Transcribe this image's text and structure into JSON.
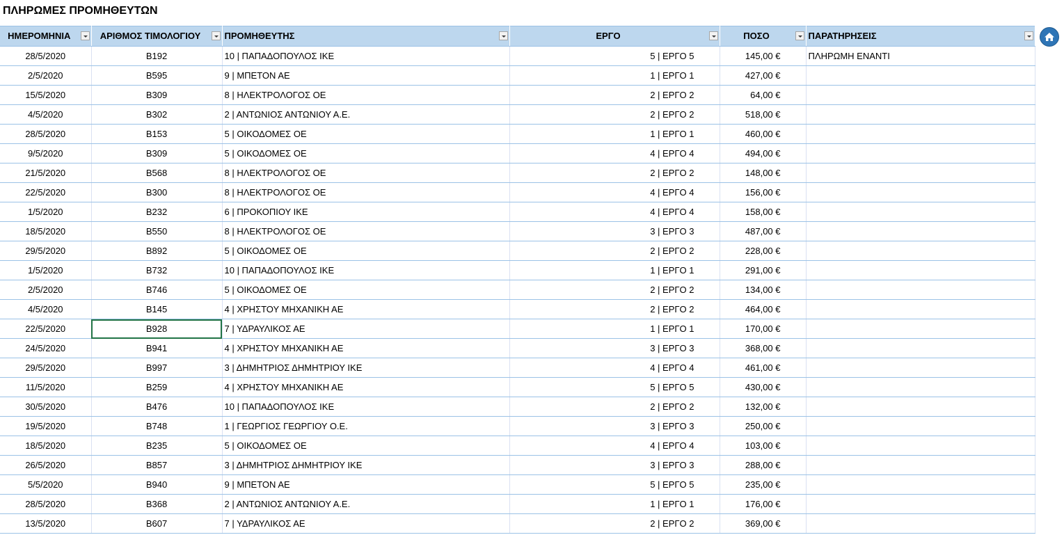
{
  "title": "ΠΛΗΡΩΜΕΣ ΠΡΟΜΗΘΕΥΤΩΝ",
  "columns": {
    "date": "ΗΜΕΡΟΜΗΝΙΑ",
    "invoice": "ΑΡΙΘΜΟΣ ΤΙΜΟΛΟΓΙΟΥ",
    "supplier": "ΠΡΟΜΗΘΕΥΤΗΣ",
    "project": "ΕΡΓΟ",
    "amount": "ΠΟΣΟ",
    "notes": "ΠΑΡΑΤΗΡΗΣΕΙΣ"
  },
  "icons": {
    "home": "home-icon",
    "filter": "filter-dropdown-icon"
  },
  "colors": {
    "header_bg": "#bdd7ee",
    "row_border": "#9bc2e6",
    "selection": "#217346",
    "home_button": "#2e75b6"
  },
  "selected_cell": {
    "row": 14,
    "column": "invoice"
  },
  "rows": [
    {
      "date": "28/5/2020",
      "invoice": "B192",
      "supplier": "10 | ΠΑΠΑΔΟΠΟΥΛΟΣ ΙΚΕ",
      "project": "5 | ΕΡΓΟ 5",
      "amount": "145,00 €",
      "notes": "ΠΛΗΡΩΜΗ ΕΝΑΝΤΙ"
    },
    {
      "date": "2/5/2020",
      "invoice": "B595",
      "supplier": "9 | ΜΠΕΤΟΝ ΑΕ",
      "project": "1 | ΕΡΓΟ 1",
      "amount": "427,00 €",
      "notes": ""
    },
    {
      "date": "15/5/2020",
      "invoice": "B309",
      "supplier": "8 | ΗΛΕΚΤΡΟΛΟΓΟΣ ΟΕ",
      "project": "2 | ΕΡΓΟ 2",
      "amount": "64,00 €",
      "notes": ""
    },
    {
      "date": "4/5/2020",
      "invoice": "B302",
      "supplier": "2 | ΑΝΤΩΝΙΟΣ ΑΝΤΩΝΙΟΥ Α.Ε.",
      "project": "2 | ΕΡΓΟ 2",
      "amount": "518,00 €",
      "notes": ""
    },
    {
      "date": "28/5/2020",
      "invoice": "B153",
      "supplier": "5 | ΟΙΚΟΔΟΜΕΣ ΟΕ",
      "project": "1 | ΕΡΓΟ 1",
      "amount": "460,00 €",
      "notes": ""
    },
    {
      "date": "9/5/2020",
      "invoice": "B309",
      "supplier": "5 | ΟΙΚΟΔΟΜΕΣ ΟΕ",
      "project": "4 | ΕΡΓΟ 4",
      "amount": "494,00 €",
      "notes": ""
    },
    {
      "date": "21/5/2020",
      "invoice": "B568",
      "supplier": "8 | ΗΛΕΚΤΡΟΛΟΓΟΣ ΟΕ",
      "project": "2 | ΕΡΓΟ 2",
      "amount": "148,00 €",
      "notes": ""
    },
    {
      "date": "22/5/2020",
      "invoice": "B300",
      "supplier": "8 | ΗΛΕΚΤΡΟΛΟΓΟΣ ΟΕ",
      "project": "4 | ΕΡΓΟ 4",
      "amount": "156,00 €",
      "notes": ""
    },
    {
      "date": "1/5/2020",
      "invoice": "B232",
      "supplier": "6 | ΠΡΟΚΟΠΙΟΥ ΙΚΕ",
      "project": "4 | ΕΡΓΟ 4",
      "amount": "158,00 €",
      "notes": ""
    },
    {
      "date": "18/5/2020",
      "invoice": "B550",
      "supplier": "8 | ΗΛΕΚΤΡΟΛΟΓΟΣ ΟΕ",
      "project": "3 | ΕΡΓΟ 3",
      "amount": "487,00 €",
      "notes": ""
    },
    {
      "date": "29/5/2020",
      "invoice": "B892",
      "supplier": "5 | ΟΙΚΟΔΟΜΕΣ ΟΕ",
      "project": "2 | ΕΡΓΟ 2",
      "amount": "228,00 €",
      "notes": ""
    },
    {
      "date": "1/5/2020",
      "invoice": "B732",
      "supplier": "10 | ΠΑΠΑΔΟΠΟΥΛΟΣ ΙΚΕ",
      "project": "1 | ΕΡΓΟ 1",
      "amount": "291,00 €",
      "notes": ""
    },
    {
      "date": "2/5/2020",
      "invoice": "B746",
      "supplier": "5 | ΟΙΚΟΔΟΜΕΣ ΟΕ",
      "project": "2 | ΕΡΓΟ 2",
      "amount": "134,00 €",
      "notes": ""
    },
    {
      "date": "4/5/2020",
      "invoice": "B145",
      "supplier": "4 | ΧΡΗΣΤΟΥ ΜΗΧΑΝΙΚΗ ΑΕ",
      "project": "2 | ΕΡΓΟ 2",
      "amount": "464,00 €",
      "notes": ""
    },
    {
      "date": "22/5/2020",
      "invoice": "B928",
      "supplier": "7 | ΥΔΡΑΥΛΙΚΟΣ ΑΕ",
      "project": "1 | ΕΡΓΟ 1",
      "amount": "170,00 €",
      "notes": ""
    },
    {
      "date": "24/5/2020",
      "invoice": "B941",
      "supplier": "4 | ΧΡΗΣΤΟΥ ΜΗΧΑΝΙΚΗ ΑΕ",
      "project": "3 | ΕΡΓΟ 3",
      "amount": "368,00 €",
      "notes": ""
    },
    {
      "date": "29/5/2020",
      "invoice": "B997",
      "supplier": "3 | ΔΗΜΗΤΡΙΟΣ ΔΗΜΗΤΡΙΟΥ ΙΚΕ",
      "project": "4 | ΕΡΓΟ 4",
      "amount": "461,00 €",
      "notes": ""
    },
    {
      "date": "11/5/2020",
      "invoice": "B259",
      "supplier": "4 | ΧΡΗΣΤΟΥ ΜΗΧΑΝΙΚΗ ΑΕ",
      "project": "5 | ΕΡΓΟ 5",
      "amount": "430,00 €",
      "notes": ""
    },
    {
      "date": "30/5/2020",
      "invoice": "B476",
      "supplier": "10 | ΠΑΠΑΔΟΠΟΥΛΟΣ ΙΚΕ",
      "project": "2 | ΕΡΓΟ 2",
      "amount": "132,00 €",
      "notes": ""
    },
    {
      "date": "19/5/2020",
      "invoice": "B748",
      "supplier": "1 | ΓΕΩΡΓΙΟΣ ΓΕΩΡΓΙΟΥ Ο.Ε.",
      "project": "3 | ΕΡΓΟ 3",
      "amount": "250,00 €",
      "notes": ""
    },
    {
      "date": "18/5/2020",
      "invoice": "B235",
      "supplier": "5 | ΟΙΚΟΔΟΜΕΣ ΟΕ",
      "project": "4 | ΕΡΓΟ 4",
      "amount": "103,00 €",
      "notes": ""
    },
    {
      "date": "26/5/2020",
      "invoice": "B857",
      "supplier": "3 | ΔΗΜΗΤΡΙΟΣ ΔΗΜΗΤΡΙΟΥ ΙΚΕ",
      "project": "3 | ΕΡΓΟ 3",
      "amount": "288,00 €",
      "notes": ""
    },
    {
      "date": "5/5/2020",
      "invoice": "B940",
      "supplier": "9 | ΜΠΕΤΟΝ ΑΕ",
      "project": "5 | ΕΡΓΟ 5",
      "amount": "235,00 €",
      "notes": ""
    },
    {
      "date": "28/5/2020",
      "invoice": "B368",
      "supplier": "2 | ΑΝΤΩΝΙΟΣ ΑΝΤΩΝΙΟΥ Α.Ε.",
      "project": "1 | ΕΡΓΟ 1",
      "amount": "176,00 €",
      "notes": ""
    },
    {
      "date": "13/5/2020",
      "invoice": "B607",
      "supplier": "7 | ΥΔΡΑΥΛΙΚΟΣ ΑΕ",
      "project": "2 | ΕΡΓΟ 2",
      "amount": "369,00 €",
      "notes": ""
    }
  ]
}
